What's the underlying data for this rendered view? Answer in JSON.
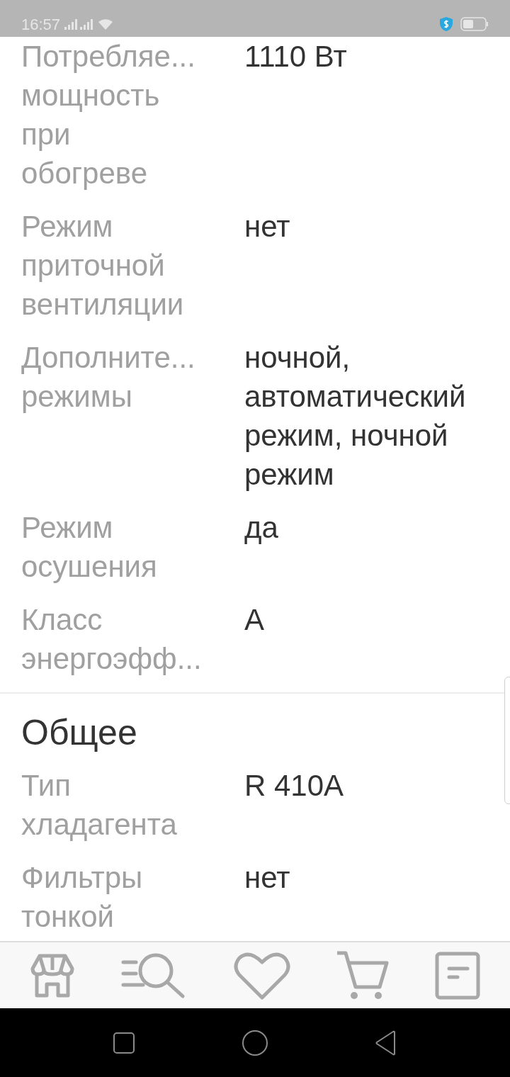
{
  "status_bar": {
    "time": "16:57"
  },
  "sections": [
    {
      "rows": [
        {
          "label": "Потребляе...\nмощность\nпри\nобогреве",
          "value": "1110 Вт"
        },
        {
          "label": "Режим\nприточной\nвентиляции",
          "value": "нет"
        },
        {
          "label": "Дополните...\nрежимы",
          "value": "ночной,\nавтоматический\nрежим, ночной\nрежим"
        },
        {
          "label": "Режим\nосушения",
          "value": "да"
        },
        {
          "label": "Класс\nэнергоэфф...",
          "value": "A"
        }
      ]
    },
    {
      "title": "Общее",
      "rows": [
        {
          "label": "Тип\nхладагента",
          "value": "R 410A"
        },
        {
          "label": "Фильтры\nтонкой",
          "value": "нет"
        }
      ]
    }
  ],
  "bottom_nav": [
    {
      "kind": "store"
    },
    {
      "kind": "search"
    },
    {
      "kind": "favorites"
    },
    {
      "kind": "cart"
    },
    {
      "kind": "orders"
    }
  ]
}
